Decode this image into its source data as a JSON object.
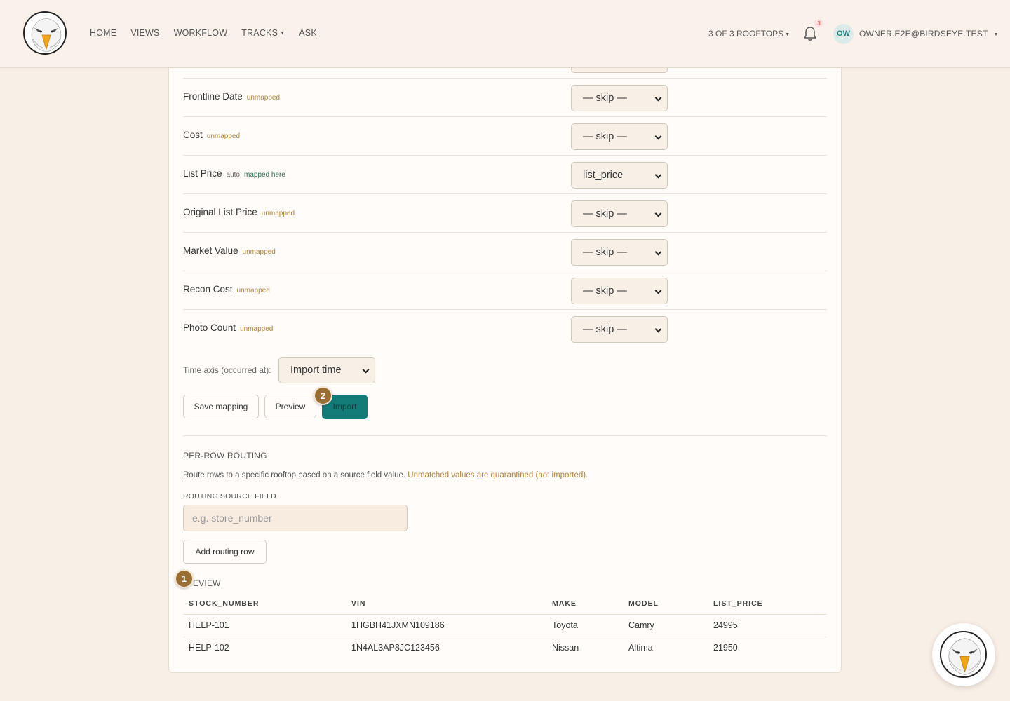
{
  "header": {
    "nav": [
      "HOME",
      "VIEWS",
      "WORKFLOW",
      "TRACKS",
      "ASK"
    ],
    "rooftops": "3 OF 3 ROOFTOPS",
    "notifications_count": "3",
    "avatar_initials": "OW",
    "user_email": "OWNER.E2E@BIRDSEYE.TEST"
  },
  "fields": [
    {
      "label": "Frontline Date",
      "status": "unmapped",
      "selected": "— skip —"
    },
    {
      "label": "Cost",
      "status": "unmapped",
      "selected": "— skip —"
    },
    {
      "label": "List Price",
      "status_auto": "auto",
      "status": "mapped here",
      "selected": "list_price"
    },
    {
      "label": "Original List Price",
      "status": "unmapped",
      "selected": "— skip —"
    },
    {
      "label": "Market Value",
      "status": "unmapped",
      "selected": "— skip —"
    },
    {
      "label": "Recon Cost",
      "status": "unmapped",
      "selected": "— skip —"
    },
    {
      "label": "Photo Count",
      "status": "unmapped",
      "selected": "— skip —"
    }
  ],
  "time_axis": {
    "label": "Time axis (occurred at):",
    "selected": "Import time"
  },
  "actions": {
    "save": "Save mapping",
    "preview": "Preview",
    "import": "Import"
  },
  "routing": {
    "title": "PER-ROW ROUTING",
    "description": "Route rows to a specific rooftop based on a source field value.",
    "warning": "Unmatched values are quarantined (not imported).",
    "source_label": "ROUTING SOURCE FIELD",
    "source_placeholder": "e.g. store_number",
    "add_button": "Add routing row"
  },
  "preview": {
    "title": "EVIEW",
    "columns": [
      "STOCK_NUMBER",
      "VIN",
      "MAKE",
      "MODEL",
      "LIST_PRICE"
    ],
    "rows": [
      [
        "HELP-101",
        "1HGBH41JXMN109186",
        "Toyota",
        "Camry",
        "24995"
      ],
      [
        "HELP-102",
        "1N4AL3AP8JC123456",
        "Nissan",
        "Altima",
        "21950"
      ]
    ]
  },
  "steps": {
    "one": "1",
    "two": "2"
  },
  "colors": {
    "accent": "#137b78",
    "step": "#9a6d33",
    "warning": "#b0823a",
    "mapped": "#2e6b4e"
  }
}
